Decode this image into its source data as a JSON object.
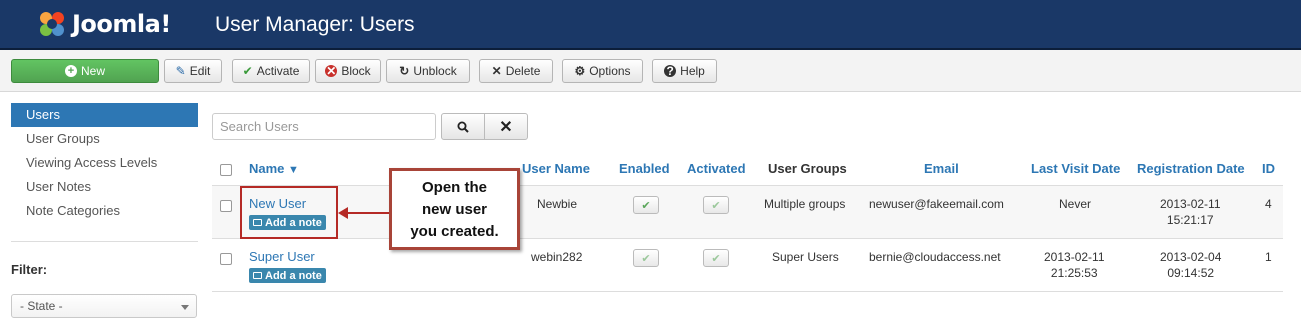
{
  "header": {
    "brand": "Joomla!",
    "title": "User Manager: Users"
  },
  "toolbar": {
    "new": "New",
    "edit": "Edit",
    "activate": "Activate",
    "block": "Block",
    "unblock": "Unblock",
    "delete": "Delete",
    "options": "Options",
    "help": "Help"
  },
  "sidebar": {
    "items": [
      "Users",
      "User Groups",
      "Viewing Access Levels",
      "User Notes",
      "Note Categories"
    ],
    "active": "Users"
  },
  "filter": {
    "label": "Filter:",
    "state": "- State -"
  },
  "search": {
    "placeholder": "Search Users"
  },
  "table": {
    "columns": {
      "name": "Name",
      "username": "User Name",
      "enabled": "Enabled",
      "activated": "Activated",
      "groups": "User Groups",
      "email": "Email",
      "last_visit": "Last Visit Date",
      "registration": "Registration Date",
      "id": "ID"
    },
    "rows": [
      {
        "name": "New User",
        "note": "Add a note",
        "username": "Newbie",
        "groups": "Multiple groups",
        "email": "newuser@fakeemail.com",
        "last_visit": "Never",
        "last_visit_time": "",
        "reg_date": "2013-02-11",
        "reg_time": "15:21:17",
        "id": "4"
      },
      {
        "name": "Super User",
        "note": "Add a note",
        "username": "webin282",
        "groups": "Super Users",
        "email": "bernie@cloudaccess.net",
        "last_visit": "2013-02-11",
        "last_visit_time": "21:25:53",
        "reg_date": "2013-02-04",
        "reg_time": "09:14:52",
        "id": "1"
      }
    ]
  },
  "annotation": {
    "line1": "Open the",
    "line2": "new user",
    "line3": "you created."
  },
  "colors": {
    "header": "#1a3867",
    "accent": "#2d77b4",
    "new_button": "#51a351",
    "callout_border": "#a84438"
  }
}
